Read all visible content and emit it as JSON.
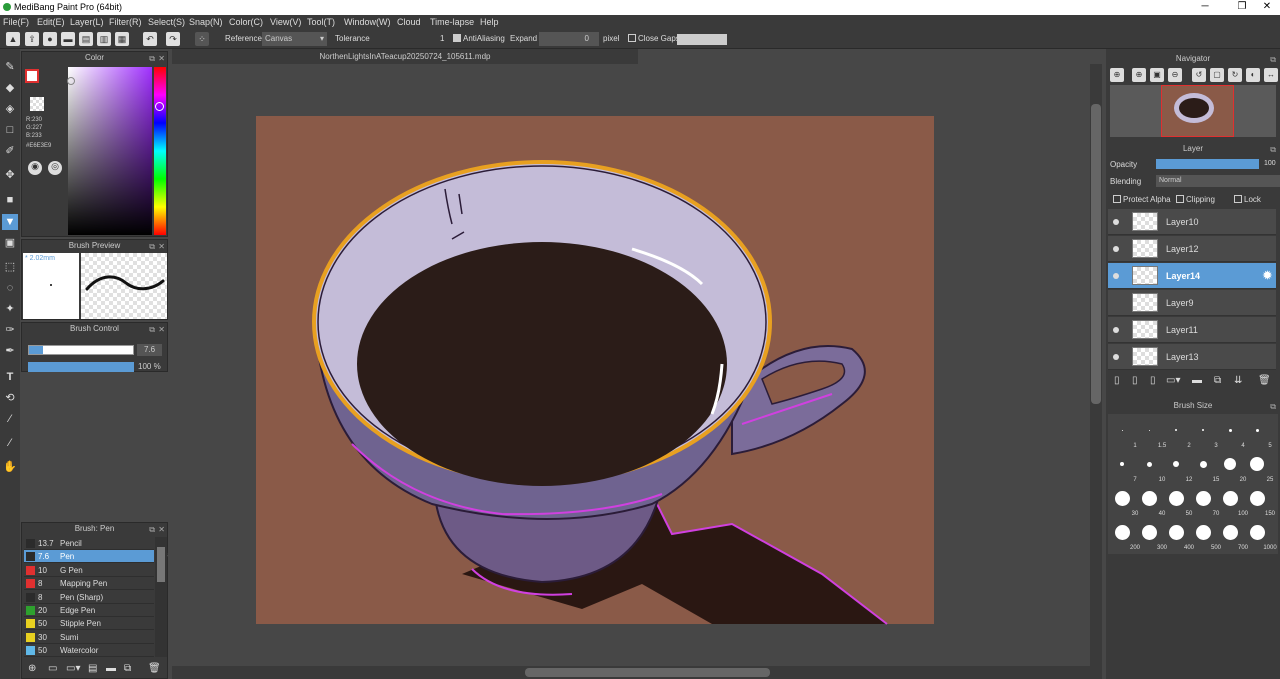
{
  "app": {
    "title": "MediBang Paint Pro (64bit)"
  },
  "menu": [
    "File(F)",
    "Edit(E)",
    "Layer(L)",
    "Filter(R)",
    "Select(S)",
    "Snap(N)",
    "Color(C)",
    "View(V)",
    "Tool(T)",
    "Window(W)",
    "Cloud",
    "Time-lapse",
    "Help"
  ],
  "toolbar": {
    "reference_label": "Reference",
    "reference_value": "Canvas",
    "tolerance_label": "Tolerance",
    "tolerance_value": "1",
    "antialiasing_label": "AntiAliasing",
    "expand_label": "Expand",
    "expand_value": "0",
    "pixel_label": "pixel",
    "close_gaps_label": "Close Gaps"
  },
  "color_panel": {
    "title": "Color",
    "r": "R:230",
    "g": "G:227",
    "b": "B:233",
    "hex": "#E6E3E9",
    "fg_color": "#e6e3e9"
  },
  "brush_preview": {
    "title": "Brush Preview",
    "size": "* 2.02mm"
  },
  "brush_control": {
    "title": "Brush Control",
    "size_value": "7.6",
    "opacity_value": "100 %"
  },
  "brush_list": {
    "title": "Brush: Pen",
    "items": [
      {
        "size": "13.7",
        "name": "Pencil",
        "color": "#2b2b2b"
      },
      {
        "size": "7.6",
        "name": "Pen",
        "color": "#2b2b2b",
        "selected": true
      },
      {
        "size": "10",
        "name": "G Pen",
        "color": "#e03030"
      },
      {
        "size": "8",
        "name": "Mapping Pen",
        "color": "#e03030"
      },
      {
        "size": "8",
        "name": "Pen (Sharp)",
        "color": "#2b2b2b"
      },
      {
        "size": "20",
        "name": "Edge Pen",
        "color": "#2ea02e"
      },
      {
        "size": "50",
        "name": "Stipple Pen",
        "color": "#e8d020"
      },
      {
        "size": "30",
        "name": "Sumi",
        "color": "#e8d020"
      },
      {
        "size": "50",
        "name": "Watercolor",
        "color": "#60b8e8"
      }
    ]
  },
  "document": {
    "tab": "NorthenLightsInATeacup20250724_105611.mdp"
  },
  "navigator": {
    "title": "Navigator"
  },
  "layer_panel": {
    "title": "Layer",
    "opacity_label": "Opacity",
    "opacity_value": "100",
    "blending_label": "Blending",
    "blending_value": "Normal",
    "protect_alpha": "Protect Alpha",
    "clipping": "Clipping",
    "lock": "Lock",
    "layers": [
      {
        "name": "Layer10",
        "selected": false
      },
      {
        "name": "Layer12",
        "selected": false
      },
      {
        "name": "Layer14",
        "selected": true
      },
      {
        "name": "Layer9",
        "selected": false
      },
      {
        "name": "Layer11",
        "selected": false
      },
      {
        "name": "Layer13",
        "selected": false
      }
    ]
  },
  "brush_size": {
    "title": "Brush Size",
    "sizes": [
      "1",
      "1.5",
      "2",
      "3",
      "4",
      "5",
      "7",
      "10",
      "12",
      "15",
      "20",
      "25",
      "30",
      "40",
      "50",
      "70",
      "100",
      "150",
      "200",
      "300",
      "400",
      "500",
      "700",
      "1000"
    ]
  }
}
